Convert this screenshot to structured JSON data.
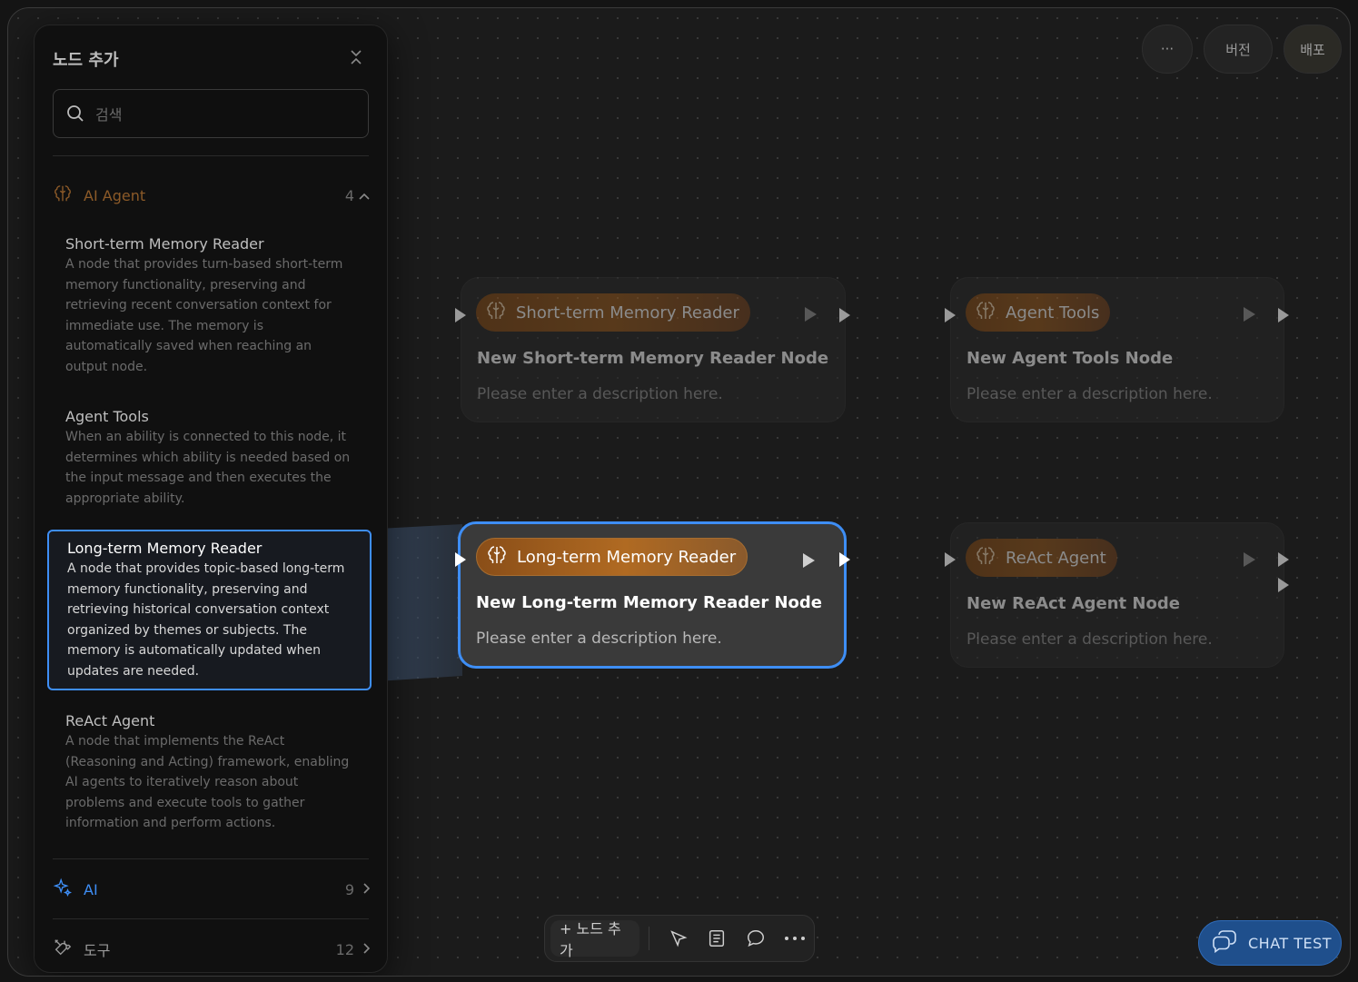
{
  "header": {
    "more_label": "···",
    "version_label": "버전",
    "deploy_label": "배포"
  },
  "panel": {
    "title": "노드 추가",
    "search_placeholder": "검색",
    "categories": [
      {
        "name": "AI Agent",
        "count": "4",
        "icon": "brain-icon",
        "color": "#a8631f"
      },
      {
        "name": "AI",
        "count": "9",
        "icon": "sparkles-icon",
        "color": "#3e8ef5"
      },
      {
        "name": "도구",
        "count": "12",
        "icon": "tools-icon",
        "color": "#9a9a9a"
      }
    ],
    "items": [
      {
        "title": "Short-term Memory Reader",
        "desc": "A node that provides turn-based short-term memory functionality, preserving and retrieving recent conversation context for immediate use. The memory is automatically saved when reaching an output node."
      },
      {
        "title": "Agent Tools",
        "desc": "When an ability is connected to this node, it determines which ability is needed based on the input message and then executes the appropriate ability."
      },
      {
        "title": "Long-term Memory Reader",
        "desc": "A node that provides topic-based long-term memory functionality, preserving and retrieving historical conversation context organized by themes or subjects. The memory is automatically updated when updates are needed."
      },
      {
        "title": "ReAct Agent",
        "desc": "A node that implements the ReAct (Reasoning and Acting) framework, enabling AI agents to iteratively reason about problems and execute tools to gather information and perform actions."
      }
    ]
  },
  "nodes": [
    {
      "type": "Short-term Memory Reader",
      "title": "New Short-term Memory Reader Node",
      "desc": "Please enter a description here."
    },
    {
      "type": "Agent Tools",
      "title": "New Agent Tools Node",
      "desc": "Please enter a description here."
    },
    {
      "type": "Long-term Memory Reader",
      "title": "New Long-term Memory Reader Node",
      "desc": "Please enter a description here."
    },
    {
      "type": "ReAct Agent",
      "title": "New ReAct Agent Node",
      "desc": "Please enter a description here."
    }
  ],
  "toolbar": {
    "add_label": "+ 노드 추가"
  },
  "chat_test": {
    "label": "CHAT TEST"
  },
  "colors": {
    "accent": "#3e8ef5",
    "agent_pill": "#8a531c"
  }
}
